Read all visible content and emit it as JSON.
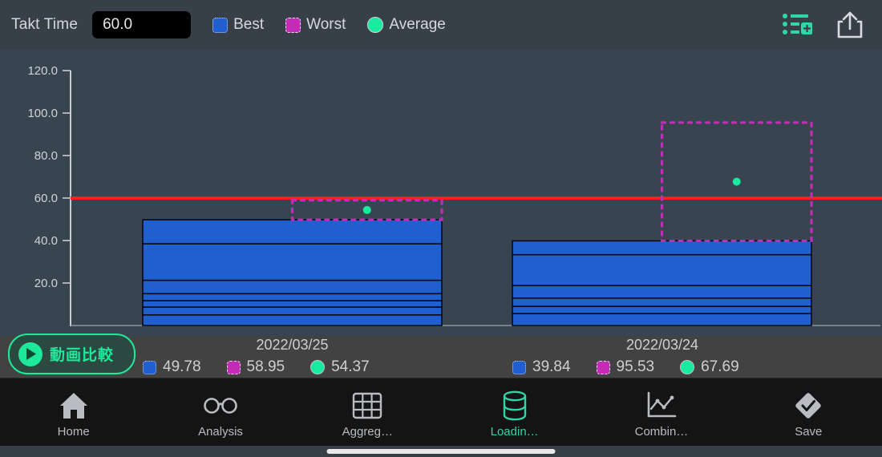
{
  "header": {
    "takt_label": "Takt Time",
    "takt_value": "60.0",
    "takt_placeholder": "60.0",
    "legend": [
      {
        "label": "Best",
        "swatch": "square",
        "color": "#1f5fd0",
        "name": "best"
      },
      {
        "label": "Worst",
        "swatch": "square-dashed",
        "color": "#c42cb5",
        "name": "worst"
      },
      {
        "label": "Average",
        "swatch": "circle",
        "color": "#18eaa0",
        "name": "average"
      }
    ],
    "icons": [
      {
        "name": "list-add-icon",
        "color": "#2fd6a6"
      },
      {
        "name": "share-export-icon",
        "color": "#d8dbde"
      }
    ]
  },
  "chart_data": {
    "type": "bar",
    "title": "",
    "xlabel": "",
    "ylabel": "",
    "ylim": [
      0,
      120
    ],
    "yticks": [
      "120.0",
      "100.0",
      "80.0",
      "60.0",
      "40.0",
      "20.0"
    ],
    "ytick_values": [
      120,
      100,
      80,
      60,
      40,
      20
    ],
    "grid": false,
    "legend_position": "top",
    "threshold": {
      "label": "Takt Time",
      "value": 60.0,
      "color": "#ff1d25"
    },
    "categories": [
      "2022/03/25",
      "2022/03/24"
    ],
    "series": [
      {
        "name": "Best",
        "color": "#1f5fd0",
        "values": [
          49.78,
          39.84
        ]
      },
      {
        "name": "Worst",
        "color": "#c42cb5",
        "values": [
          58.95,
          95.53
        ]
      },
      {
        "name": "Average",
        "color": "#18eaa0",
        "values": [
          54.37,
          67.69
        ]
      }
    ],
    "groups": [
      {
        "date": "2022/03/25",
        "best": 49.78,
        "worst": 58.95,
        "average": 54.37,
        "best_stack": [
          5.0,
          3.7,
          3.0,
          3.3,
          6.3,
          17.2,
          11.3
        ]
      },
      {
        "date": "2022/03/24",
        "best": 39.84,
        "worst": 95.53,
        "average": 67.69,
        "best_stack": [
          5.6,
          3.4,
          3.9,
          5.9,
          14.5,
          6.5
        ]
      }
    ]
  },
  "legend_strip": {
    "groups": [
      {
        "date": "2022/03/25",
        "values": [
          {
            "kind": "best",
            "text": "49.78"
          },
          {
            "kind": "worst",
            "text": "58.95"
          },
          {
            "kind": "average",
            "text": "54.37"
          }
        ]
      },
      {
        "date": "2022/03/24",
        "values": [
          {
            "kind": "best",
            "text": "39.84"
          },
          {
            "kind": "worst",
            "text": "95.53"
          },
          {
            "kind": "average",
            "text": "67.69"
          }
        ]
      }
    ]
  },
  "video_compare": {
    "label": "動画比較",
    "icon": "play-icon",
    "color": "#1fe89a"
  },
  "tabbar": {
    "items": [
      {
        "label": "Home",
        "icon": "home-icon",
        "active": false
      },
      {
        "label": "Analysis",
        "icon": "glasses-icon",
        "active": false
      },
      {
        "label": "Aggreg…",
        "icon": "grid-table-icon",
        "active": false
      },
      {
        "label": "Loadin…",
        "icon": "database-icon",
        "active": true
      },
      {
        "label": "Combin…",
        "icon": "line-chart-icon",
        "active": false
      },
      {
        "label": "Save",
        "icon": "diamond-check-icon",
        "active": false
      }
    ]
  }
}
